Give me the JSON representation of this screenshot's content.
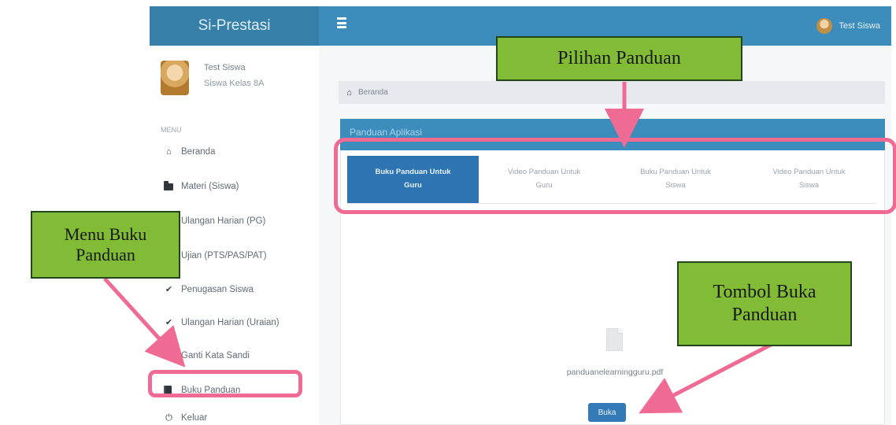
{
  "app": {
    "title": "Si-Prestasi",
    "topbar_user": "Test Siswa"
  },
  "sidebar": {
    "user_name": "Test Siswa",
    "user_class": "Siswa Kelas 8A",
    "menu_header": "MENU",
    "items": [
      {
        "label": "Beranda",
        "icon": "home-icon"
      },
      {
        "label": "Materi (Siswa)",
        "icon": "folder-icon"
      },
      {
        "label": "Ulangan Harian (PG)",
        "icon": "check-icon"
      },
      {
        "label": "Ujian (PTS/PAS/PAT)",
        "icon": "check-icon"
      },
      {
        "label": "Penugasan Siswa",
        "icon": "check-icon"
      },
      {
        "label": "Ulangan Harian (Uraian)",
        "icon": "check-icon"
      },
      {
        "label": "Ganti Kata Sandi",
        "icon": "key-icon"
      },
      {
        "label": "Buku Panduan",
        "icon": "book-icon"
      },
      {
        "label": "Keluar",
        "icon": "power-icon"
      }
    ]
  },
  "content": {
    "breadcrumb": "Beranda",
    "panel_title": "Panduan Aplikasi",
    "tabs": [
      {
        "label": "Buku Panduan Untuk\nGuru",
        "active": true
      },
      {
        "label": "Video Panduan Untuk\nGuru",
        "active": false
      },
      {
        "label": "Buku Panduan Untuk\nSiswa",
        "active": false
      },
      {
        "label": "Video Panduan Untuk\nSiswa",
        "active": false
      }
    ],
    "file_name": "panduanelearningguru.pdf",
    "open_button": "Buka"
  },
  "annotations": {
    "tabs_callout": "Pilihan Panduan",
    "menu_callout": "Menu Buku Panduan",
    "button_callout": "Tombol Buka Panduan"
  },
  "colors": {
    "primary_blue": "#3c8dbc",
    "active_tab": "#2e73b2",
    "highlight_pink": "#f06b93",
    "callout_green": "#82bb35"
  }
}
